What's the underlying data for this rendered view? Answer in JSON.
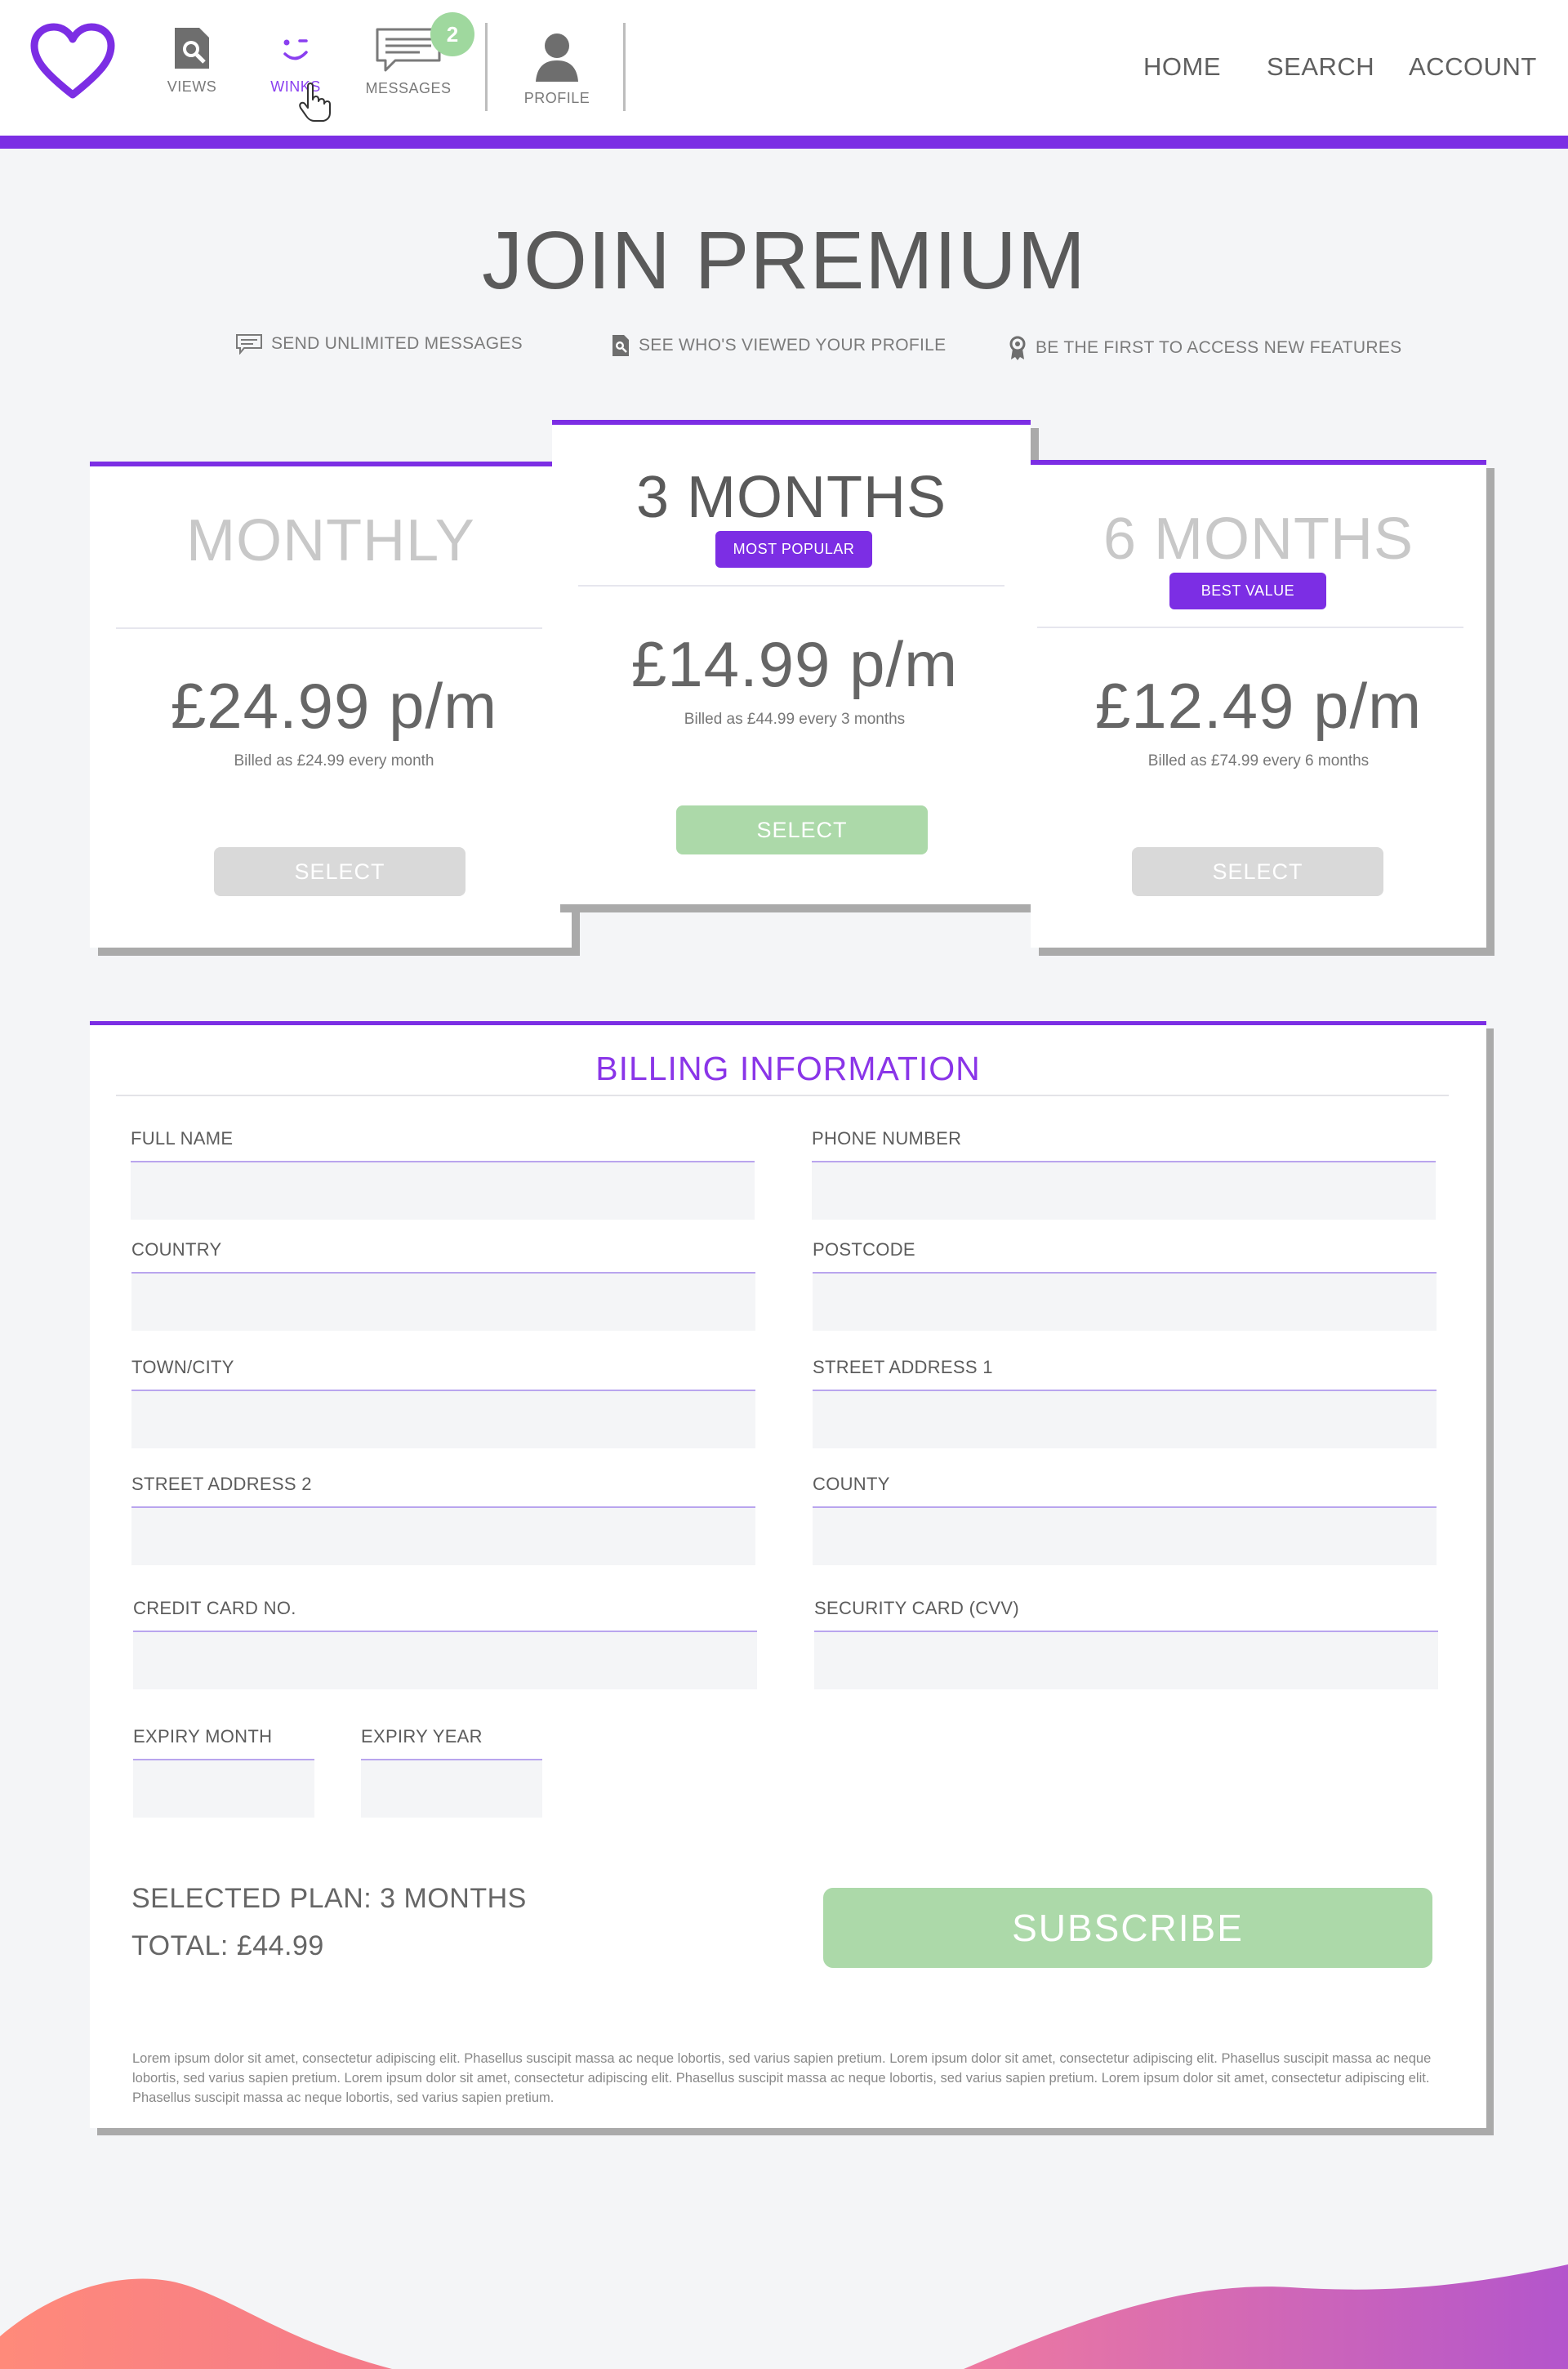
{
  "colors": {
    "accent": "#7c2ee4",
    "success_button": "#acd9a9",
    "disabled_button": "#d9d9d9",
    "badge": "#9fd89e",
    "background": "#f4f5f7"
  },
  "header": {
    "logo_icon": "heart-outline-icon",
    "icons": [
      {
        "label": "VIEWS",
        "icon": "magnify-document-icon",
        "active": false
      },
      {
        "label": "WINKS",
        "icon": "wink-face-icon",
        "active": true
      },
      {
        "label": "MESSAGES",
        "icon": "chat-bubble-icon",
        "active": false,
        "badge": "2"
      },
      {
        "label": "PROFILE",
        "icon": "person-icon",
        "active": false
      }
    ],
    "nav": {
      "home": "HOME",
      "search": "SEARCH",
      "account": "ACCOUNT"
    }
  },
  "page": {
    "title": "JOIN PREMIUM",
    "features": [
      {
        "icon": "chat-bubble-icon",
        "text": "SEND UNLIMITED MESSAGES"
      },
      {
        "icon": "magnify-document-icon",
        "text": "SEE WHO'S VIEWED YOUR PROFILE"
      },
      {
        "icon": "award-ribbon-icon",
        "text": "BE THE FIRST TO ACCESS NEW FEATURES"
      }
    ]
  },
  "plans": [
    {
      "name": "MONTHLY",
      "tag": "",
      "price": "£24.99 p/m",
      "billed": "Billed as £24.99 every month",
      "button": "SELECT",
      "selected": false
    },
    {
      "name": "3 MONTHS",
      "tag": "MOST POPULAR",
      "price": "£14.99 p/m",
      "billed": "Billed as £44.99 every 3 months",
      "button": "SELECT",
      "selected": true
    },
    {
      "name": "6 MONTHS",
      "tag": "BEST VALUE",
      "price": "£12.49 p/m",
      "billed": "Billed as £74.99 every 6 months",
      "button": "SELECT",
      "selected": false
    }
  ],
  "billing": {
    "title": "BILLING INFORMATION",
    "fields": {
      "full_name": {
        "label": "FULL  NAME",
        "value": ""
      },
      "phone": {
        "label": "PHONE NUMBER",
        "value": ""
      },
      "country": {
        "label": "COUNTRY",
        "value": ""
      },
      "postcode": {
        "label": "POSTCODE",
        "value": ""
      },
      "town": {
        "label": "TOWN/CITY",
        "value": ""
      },
      "street1": {
        "label": "STREET ADDRESS 1",
        "value": ""
      },
      "street2": {
        "label": "STREET ADDRESS 2",
        "value": ""
      },
      "county": {
        "label": "COUNTY",
        "value": ""
      },
      "card": {
        "label": "CREDIT CARD NO.",
        "value": ""
      },
      "cvv": {
        "label": "SECURITY CARD (CVV)",
        "value": ""
      },
      "expiry_month": {
        "label": "EXPIRY MONTH",
        "value": ""
      },
      "expiry_year": {
        "label": "EXPIRY YEAR",
        "value": ""
      }
    },
    "selected_plan": "SELECTED PLAN: 3 MONTHS",
    "total": "TOTAL: £44.99",
    "subscribe": "SUBSCRIBE",
    "legal": "Lorem ipsum dolor sit amet, consectetur adipiscing elit. Phasellus suscipit massa ac neque lobortis, sed varius sapien pretium. Lorem ipsum dolor sit amet, consectetur adipiscing elit. Phasellus suscipit massa ac neque lobortis, sed varius sapien pretium. Lorem ipsum dolor sit amet, consectetur adipiscing elit. Phasellus suscipit massa ac neque lobortis, sed varius sapien pretium. Lorem ipsum dolor sit amet, consectetur adipiscing elit. Phasellus suscipit massa ac neque lobortis, sed varius sapien pretium."
  }
}
